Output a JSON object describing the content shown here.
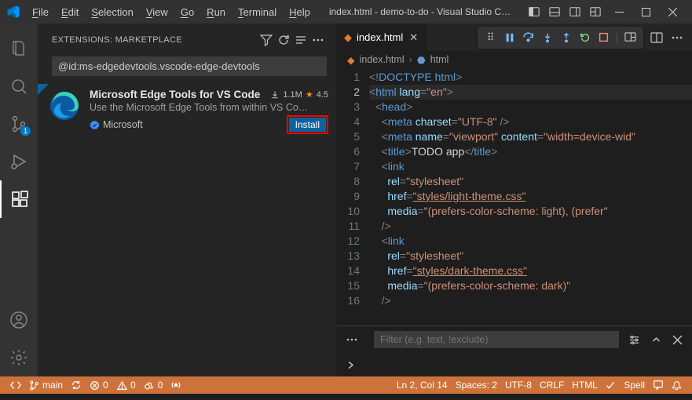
{
  "titlebar": {
    "title": "index.html - demo-to-do - Visual Studio C…",
    "menu": [
      "File",
      "Edit",
      "Selection",
      "View",
      "Go",
      "Run",
      "Terminal",
      "Help"
    ]
  },
  "activitybar": {
    "scm_badge": "1"
  },
  "sidebar": {
    "header": "EXTENSIONS: MARKETPLACE",
    "search_value": "@id:ms-edgedevtools.vscode-edge-devtools",
    "ext": {
      "name": "Microsoft Edge Tools for VS Code",
      "downloads": "1.1M",
      "rating": "4.5",
      "desc": "Use the Microsoft Edge Tools from within VS Co…",
      "publisher": "Microsoft",
      "install": "Install"
    }
  },
  "editor": {
    "tab": "index.html",
    "breadcrumb": {
      "file": "index.html",
      "node": "html"
    },
    "filter_placeholder": "Filter (e.g. text, !exclude)",
    "lines": [
      {
        "n": 1,
        "t": "<!DOCTYPE html>"
      },
      {
        "n": 2,
        "t": "<html lang=\"en\">"
      },
      {
        "n": 3,
        "t": "  <head>"
      },
      {
        "n": 4,
        "t": "    <meta charset=\"UTF-8\" />"
      },
      {
        "n": 5,
        "t": "    <meta name=\"viewport\" content=\"width=device-wid"
      },
      {
        "n": 6,
        "t": "    <title>TODO app</title>"
      },
      {
        "n": 7,
        "t": "    <link"
      },
      {
        "n": 8,
        "t": "      rel=\"stylesheet\""
      },
      {
        "n": 9,
        "t": "      href=\"styles/light-theme.css\""
      },
      {
        "n": 10,
        "t": "      media=\"(prefers-color-scheme: light), (prefer"
      },
      {
        "n": 11,
        "t": "    />"
      },
      {
        "n": 12,
        "t": "    <link"
      },
      {
        "n": 13,
        "t": "      rel=\"stylesheet\""
      },
      {
        "n": 14,
        "t": "      href=\"styles/dark-theme.css\""
      },
      {
        "n": 15,
        "t": "      media=\"(prefers-color-scheme: dark)\""
      },
      {
        "n": 16,
        "t": "    />"
      }
    ]
  },
  "status": {
    "remote": "",
    "branch": "main",
    "sync": "",
    "errors": "0",
    "warnings": "0",
    "ports": "0",
    "line_col": "Ln 2, Col 14",
    "spaces": "Spaces: 2",
    "encoding": "UTF-8",
    "eol": "CRLF",
    "lang": "HTML",
    "spell": "Spell"
  }
}
